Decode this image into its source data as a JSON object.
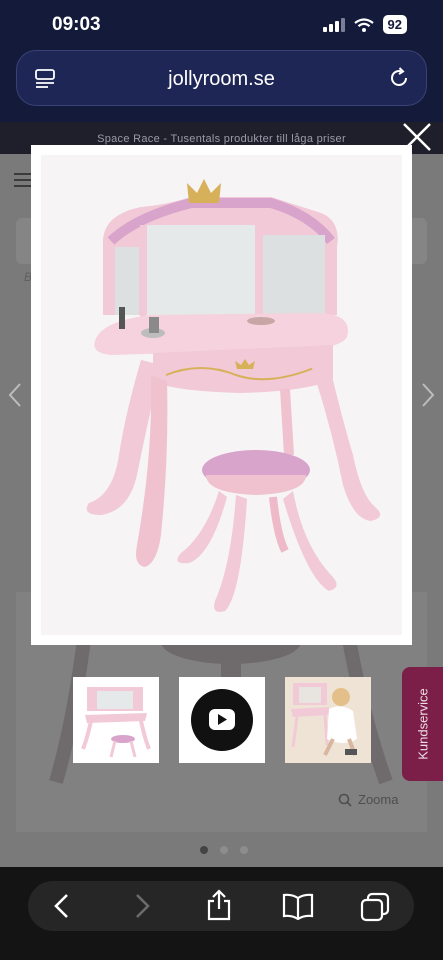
{
  "status_bar": {
    "time": "09:03",
    "battery": "92"
  },
  "browser": {
    "url": "jollyroom.se"
  },
  "page": {
    "promo": "Space Race - Tusentals produkter till låga priser",
    "crumb_letter": "B",
    "zoom_label": "Zooma",
    "side_tab_label": "Kundservice"
  },
  "gallery": {
    "thumbnails": [
      "vanity-photo",
      "video",
      "lifestyle-photo"
    ],
    "active_dot": 0
  },
  "colors": {
    "pink": "#f2c9d6",
    "lilac": "#d8a4cc",
    "gold": "#d7b15a",
    "side_tab": "#7b1f48",
    "status_bg": "#141a3a"
  }
}
